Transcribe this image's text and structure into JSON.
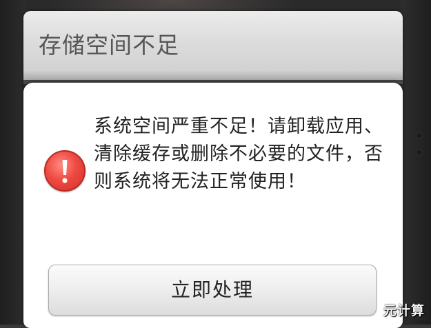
{
  "dialog": {
    "title": "存储空间不足",
    "message": "系统空间严重不足！请卸载应用、清除缓存或删除不必要的文件，否则系统将无法正常使用！",
    "icon": "warning-icon",
    "action_label": "立即处理"
  },
  "watermark": {
    "text": "元计算"
  },
  "colors": {
    "warning_red": "#e8413a",
    "header_gray": "#dcdcdc",
    "title_text": "#555555"
  }
}
